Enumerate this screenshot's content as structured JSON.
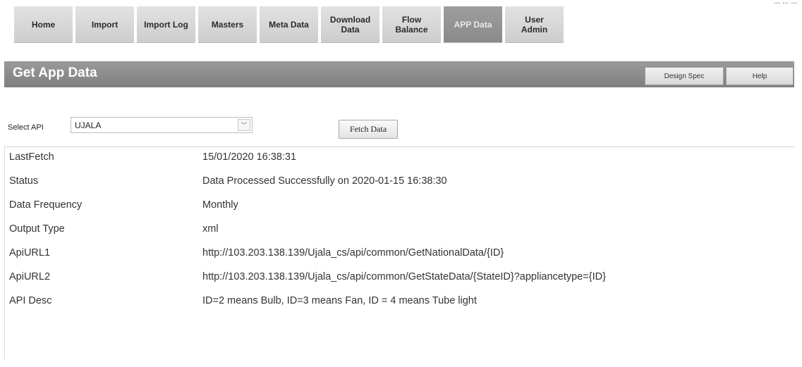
{
  "nav": {
    "items": [
      {
        "label": "Home"
      },
      {
        "label": "Import"
      },
      {
        "label": "Import Log"
      },
      {
        "label": "Masters"
      },
      {
        "label": "Meta Data"
      },
      {
        "label": "Download\nData"
      },
      {
        "label": "Flow\nBalance"
      },
      {
        "label": "APP Data"
      },
      {
        "label": "User\nAdmin"
      }
    ],
    "active": "APP Data",
    "top_right_text": "... ... ..."
  },
  "title_bar": {
    "title": "Get App Data",
    "design_spec_label": "Design Spec",
    "help_label": "Help"
  },
  "api_select": {
    "label": "Select API",
    "value": "UJALA",
    "dropdown_glyph": "﹀"
  },
  "fetch_button": {
    "label": "Fetch Data"
  },
  "details": [
    {
      "key": "LastFetch",
      "value": "15/01/2020 16:38:31"
    },
    {
      "key": "Status",
      "value": "Data Processed Successfully on 2020-01-15 16:38:30"
    },
    {
      "key": "Data Frequency",
      "value": "Monthly"
    },
    {
      "key": "Output Type",
      "value": "xml"
    },
    {
      "key": "ApiURL1",
      "value": "http://103.203.138.139/Ujala_cs/api/common/GetNationalData/{ID}"
    },
    {
      "key": "ApiURL2",
      "value": "http://103.203.138.139/Ujala_cs/api/common/GetStateData/{StateID}?appliancetype={ID}"
    },
    {
      "key": "API Desc",
      "value": "ID=2 means Bulb, ID=3 means Fan, ID = 4 means Tube light"
    }
  ],
  "colors": {
    "nav_bg": "#d6d6d6",
    "nav_active_bg": "#949494",
    "title_bar_bg": "#8c8c8c",
    "title_text": "#ffffff"
  }
}
